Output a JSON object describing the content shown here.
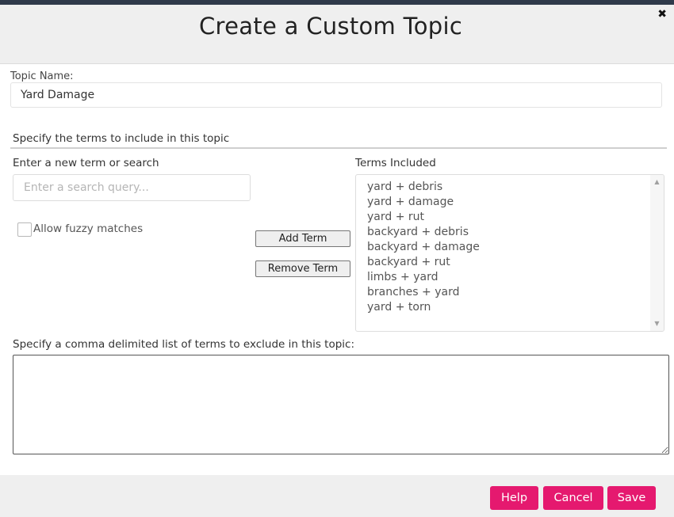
{
  "dialog": {
    "title": "Create a Custom Topic",
    "close_glyph": "✖",
    "close_icon": "close-icon"
  },
  "topic": {
    "label": "Topic Name:",
    "value": "Yard Damage"
  },
  "section": {
    "heading": "Specify the terms to include in this topic"
  },
  "search": {
    "label": "Enter a new term or search",
    "placeholder": "Enter a search query..."
  },
  "fuzzy": {
    "label": "Allow fuzzy matches",
    "checked": false
  },
  "actions": {
    "add_label": "Add Term",
    "remove_label": "Remove Term"
  },
  "terms": {
    "label": "Terms Included",
    "items": [
      "yard + debris",
      "yard + damage",
      "yard + rut",
      "backyard + debris",
      "backyard + damage",
      "backyard + rut",
      "limbs + yard",
      "branches + yard",
      "yard + torn"
    ],
    "scroll_up_glyph": "▲",
    "scroll_down_glyph": "▼"
  },
  "exclude": {
    "label": "Specify a comma delimited list of terms to exclude in this topic:",
    "value": ""
  },
  "footer": {
    "help_label": "Help",
    "cancel_label": "Cancel",
    "save_label": "Save"
  },
  "colors": {
    "accent": "#e5196f",
    "topbar": "#2f3a4a",
    "header_bg": "#efefef"
  }
}
